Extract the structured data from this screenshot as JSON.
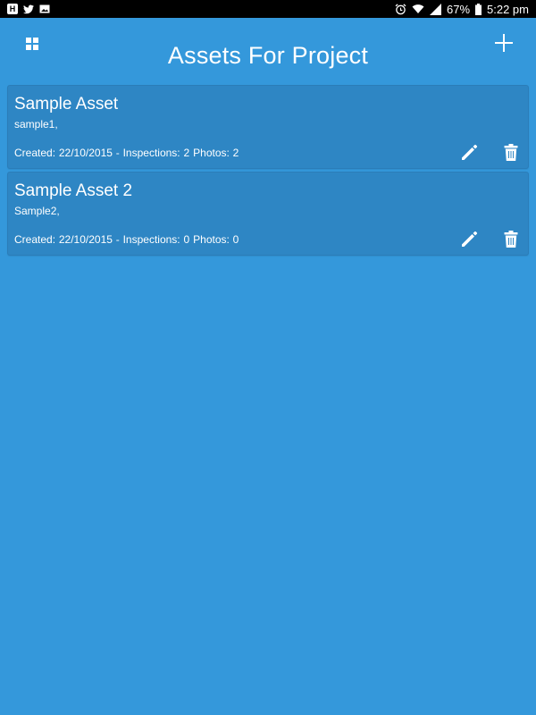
{
  "status_bar": {
    "notification_icons": [
      "H",
      "twitter-icon",
      "image-icon"
    ],
    "battery": "67%",
    "time": "5:22 pm"
  },
  "header": {
    "title": "Assets For Project",
    "menu_icon": "grid-icon",
    "add_icon": "plus-icon"
  },
  "assets": [
    {
      "name": "Sample Asset",
      "description": "sample1,",
      "created": "Created: 22/10/2015 - Inspections: 2",
      "photos": "Photos: 2"
    },
    {
      "name": "Sample Asset 2",
      "description": "Sample2,",
      "created": "Created: 22/10/2015 - Inspections: 0",
      "photos": "Photos: 0"
    }
  ],
  "colors": {
    "background": "#3498db",
    "card": "#2e86c4",
    "text": "#ffffff"
  }
}
